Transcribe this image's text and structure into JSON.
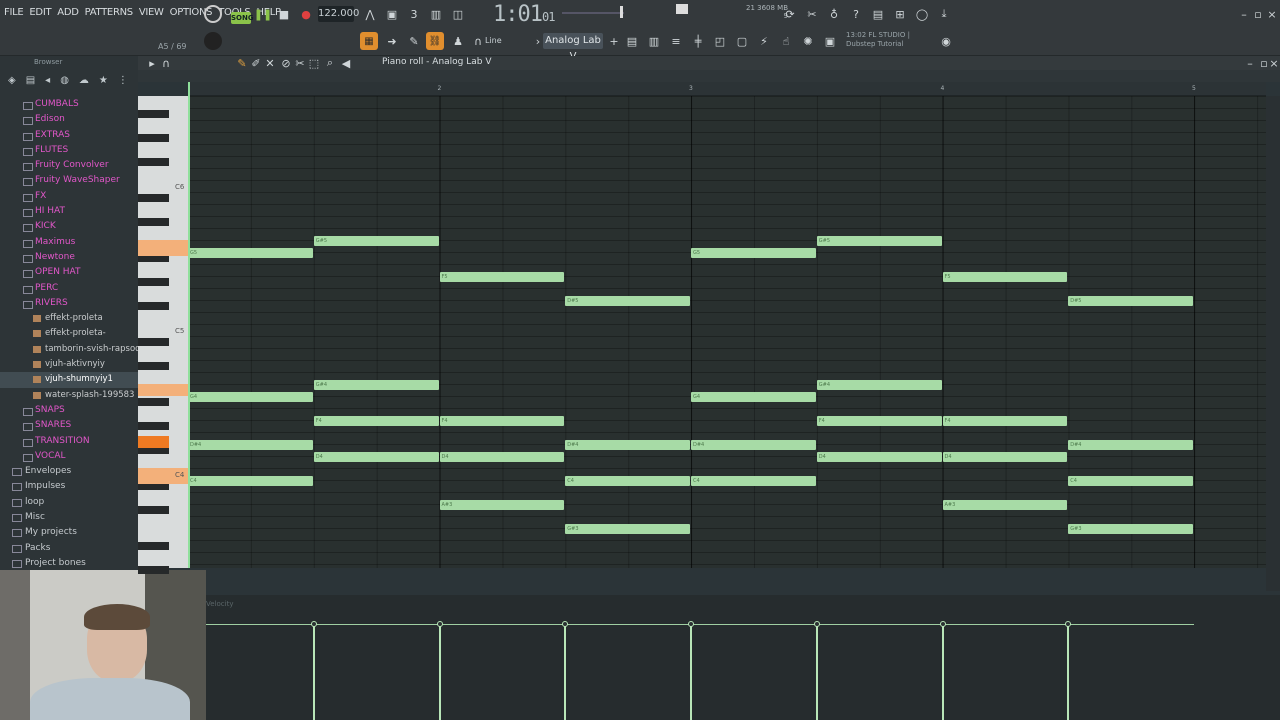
{
  "menu": [
    "FILE",
    "EDIT",
    "ADD",
    "PATTERNS",
    "VIEW",
    "OPTIONS",
    "TOOLS",
    "HELP"
  ],
  "transport": {
    "mode": "SONG",
    "tempo": "122.000",
    "time_main": "1:01",
    "time_sub": "01"
  },
  "memory": {
    "line1": "21   3608 MB",
    "line2": "9"
  },
  "hint": {
    "position": "A5 / 69"
  },
  "toolbar": {
    "snap": "Line",
    "pattern": "Analog Lab V",
    "studio_line1": "13:02  FL STUDIO |",
    "studio_line2": "Dubstep Tutorial"
  },
  "browser": {
    "title": "Browser",
    "items": [
      {
        "label": "CUMBALS",
        "kind": "folder"
      },
      {
        "label": "Edison",
        "kind": "folder"
      },
      {
        "label": "EXTRAS",
        "kind": "folder"
      },
      {
        "label": "FLUTES",
        "kind": "folder"
      },
      {
        "label": "Fruity Convolver",
        "kind": "folder"
      },
      {
        "label": "Fruity WaveShaper",
        "kind": "folder"
      },
      {
        "label": "FX",
        "kind": "folder"
      },
      {
        "label": "HI HAT",
        "kind": "folder"
      },
      {
        "label": "KICK",
        "kind": "folder"
      },
      {
        "label": "Maximus",
        "kind": "folder"
      },
      {
        "label": "Newtone",
        "kind": "folder"
      },
      {
        "label": "OPEN HAT",
        "kind": "folder"
      },
      {
        "label": "PERC",
        "kind": "folder"
      },
      {
        "label": "RIVERS",
        "kind": "folder"
      },
      {
        "label": "effekt-proleta",
        "kind": "file"
      },
      {
        "label": "effekt-proleta-",
        "kind": "file"
      },
      {
        "label": "tamborin-svish-rapsodiz",
        "kind": "file"
      },
      {
        "label": "vjuh-aktivnyiy",
        "kind": "file"
      },
      {
        "label": "vjuh-shumnyiy1",
        "kind": "file-selected"
      },
      {
        "label": "water-splash-199583",
        "kind": "file"
      },
      {
        "label": "SNAPS",
        "kind": "folder"
      },
      {
        "label": "SNARES",
        "kind": "folder"
      },
      {
        "label": "TRANSITION",
        "kind": "folder"
      },
      {
        "label": "VOCAL",
        "kind": "folder"
      },
      {
        "label": "Envelopes",
        "kind": "gray"
      },
      {
        "label": "Impulses",
        "kind": "gray"
      },
      {
        "label": "loop",
        "kind": "gray"
      },
      {
        "label": "Misc",
        "kind": "gray"
      },
      {
        "label": "My projects",
        "kind": "gray"
      },
      {
        "label": "Packs",
        "kind": "gray"
      },
      {
        "label": "Project bones",
        "kind": "gray"
      }
    ]
  },
  "piano_roll": {
    "title": "Piano roll - Analog Lab V",
    "ruler": [
      "2",
      "3",
      "4",
      "5"
    ],
    "key_labels": [
      "C6",
      "C5",
      "C4"
    ],
    "notes": [
      {
        "label": "G5",
        "bar": 1,
        "row": 12.7
      },
      {
        "label": "G#5",
        "bar": 2,
        "row": 11.7
      },
      {
        "label": "F5",
        "bar": 3,
        "row": 14.7
      },
      {
        "label": "D#5",
        "bar": 4,
        "row": 16.7
      },
      {
        "label": "G5",
        "bar": 5,
        "row": 12.7
      },
      {
        "label": "G#5",
        "bar": 6,
        "row": 11.7
      },
      {
        "label": "F5",
        "bar": 7,
        "row": 14.7
      },
      {
        "label": "D#5",
        "bar": 8,
        "row": 16.7
      },
      {
        "label": "G#4",
        "bar": 2,
        "row": 23.7
      },
      {
        "label": "G4",
        "bar": 1,
        "row": 24.7
      },
      {
        "label": "G4",
        "bar": 5,
        "row": 24.7
      },
      {
        "label": "G#4",
        "bar": 6,
        "row": 23.7
      },
      {
        "label": "F4",
        "bar": 2,
        "row": 26.7
      },
      {
        "label": "F4",
        "bar": 3,
        "row": 26.7
      },
      {
        "label": "F4",
        "bar": 6,
        "row": 26.7
      },
      {
        "label": "F4",
        "bar": 7,
        "row": 26.7
      },
      {
        "label": "D#4",
        "bar": 1,
        "row": 28.7
      },
      {
        "label": "D#4",
        "bar": 4,
        "row": 28.7
      },
      {
        "label": "D#4",
        "bar": 5,
        "row": 28.7
      },
      {
        "label": "D#4",
        "bar": 8,
        "row": 28.7
      },
      {
        "label": "D4",
        "bar": 2,
        "row": 29.7
      },
      {
        "label": "D4",
        "bar": 3,
        "row": 29.7
      },
      {
        "label": "D4",
        "bar": 6,
        "row": 29.7
      },
      {
        "label": "D4",
        "bar": 7,
        "row": 29.7
      },
      {
        "label": "C4",
        "bar": 1,
        "row": 31.7
      },
      {
        "label": "C4",
        "bar": 4,
        "row": 31.7
      },
      {
        "label": "C4",
        "bar": 5,
        "row": 31.7
      },
      {
        "label": "C4",
        "bar": 8,
        "row": 31.7
      },
      {
        "label": "A#3",
        "bar": 3,
        "row": 33.7
      },
      {
        "label": "A#3",
        "bar": 7,
        "row": 33.7
      },
      {
        "label": "G#3",
        "bar": 4,
        "row": 35.7
      },
      {
        "label": "G#3",
        "bar": 8,
        "row": 35.7
      }
    ]
  },
  "velocity": {
    "label": "Velocity"
  },
  "colors": {
    "note": "#a7dba6",
    "accent": "#e08e2e",
    "folder": "#e157c9"
  }
}
